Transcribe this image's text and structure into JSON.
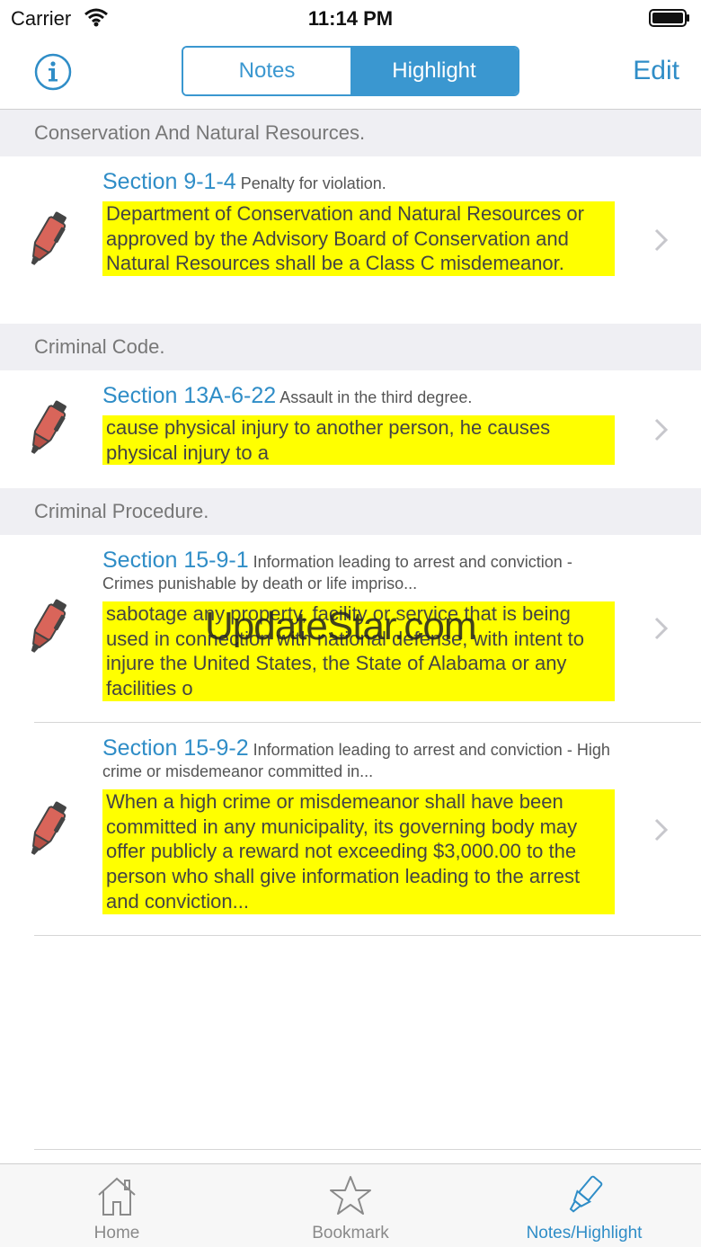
{
  "status_bar": {
    "carrier": "Carrier",
    "time": "11:14 PM"
  },
  "nav": {
    "info_icon": "info-circle-icon",
    "segments": [
      "Notes",
      "Highlight"
    ],
    "selected_segment": "Highlight",
    "edit_label": "Edit"
  },
  "groups": [
    {
      "header": "Conservation And Natural Resources.",
      "rows": [
        {
          "section": "Section 9-1-4",
          "title": "Penalty for violation.",
          "highlight": "Department of Conservation and Natural Resources or approved by the Advisory Board of Conservation and Natural Resources shall be a Class C misdemeanor."
        }
      ]
    },
    {
      "header": "Criminal Code.",
      "rows": [
        {
          "section": "Section 13A-6-22",
          "title": "Assault in the third degree.",
          "highlight": "cause physical injury to another person, he causes physical injury to a"
        }
      ]
    },
    {
      "header": "Criminal Procedure.",
      "rows": [
        {
          "section": "Section 15-9-1",
          "title": "Information leading to arrest and conviction - Crimes punishable by death or life impriso...",
          "highlight": "sabotage any property, facility or service that is being used in connection with national defense, with intent to injure the United States, the State of Alabama or any facilities o"
        },
        {
          "section": "Section 15-9-2",
          "title": "Information leading to arrest and conviction - High crime or misdemeanor committed in...",
          "highlight": "When a high crime or misdemeanor shall have been committed in any municipality, its governing body may offer publicly a reward not exceeding $3,000.00 to the person who shall give information leading to the arrest and conviction..."
        }
      ]
    }
  ],
  "watermark": "UpdateStar.com",
  "tabs": [
    {
      "label": "Home",
      "icon": "home-icon",
      "active": false
    },
    {
      "label": "Bookmark",
      "icon": "star-icon",
      "active": false
    },
    {
      "label": "Notes/Highlight",
      "icon": "highlighter-icon",
      "active": true
    }
  ],
  "colors": {
    "accent": "#2f8dc7",
    "highlight": "#ffff00",
    "section_header_bg": "#efeff3",
    "marker": "#d9655a"
  }
}
